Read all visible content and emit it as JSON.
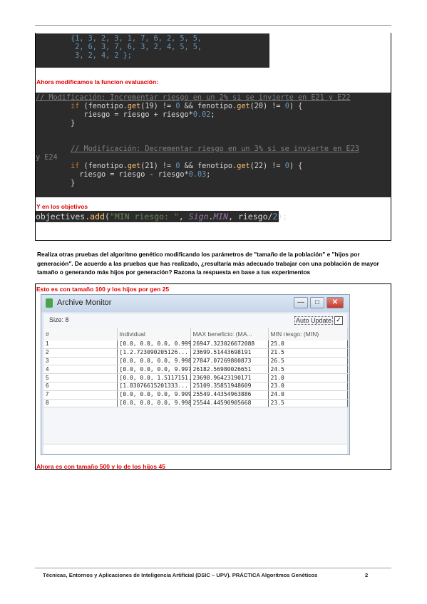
{
  "code1": {
    "lines": [
      "        {1, 3, 2, 3, 1, 7, 6, 2, 5, 5,",
      "         2, 6, 3, 7, 6, 3, 2, 4, 5, 5,",
      "         3, 2, 4, 2 };"
    ]
  },
  "label_eval": "Ahora modificamos la funcion evaluación:",
  "code2": {
    "c1": "// Modificación: Incrementar riesgo en un 2% si se invierte en E21 y E22",
    "if1_a": "if",
    "if1_b": "(fenotipo.",
    "get": "get",
    "if1_c": "(19) != ",
    "zero": "0",
    "if1_d": " && fenotipo.",
    "if1_e": "(20) != ",
    "if1_f": ") {",
    "line2_a": "riesgo = riesgo + riesgo*",
    "line2_b": "0.02",
    "semi": ";",
    "brace": "}",
    "c2a": "// Modificación: Decrementar riesgo en un 3% si se invierte en E23",
    "c2b": "y E24",
    "if2_c": "(21) != ",
    "if2_e": "(22) != ",
    "line5_a": "riesgo = riesgo - riesgo*",
    "line5_b": "0.03"
  },
  "label_obj": "Y en los objetivos",
  "code3": {
    "a": "objectives.",
    "add": "add",
    "b": "(",
    "str": "\"MIN riesgo: \"",
    "c": ", ",
    "sign": "Sign",
    "dot": ".",
    "min": "MIN",
    "d": ", riesgo/",
    "two": "2",
    "e": ");"
  },
  "paragraph": "Realiza otras pruebas del algoritmo genético modificando los parámetros de \"tamaño de la población\" e \"hijos por generación\". De acuerdo a las pruebas que has realizado, ¿resultaría más adecuado trabajar con una población de mayor tamaño o generando más hijos por generación? Razona la respuesta en base a tus experimentos",
  "label_100": "Esto es con tamaño 100 y los hijos por gen 25",
  "window": {
    "title": "Archive Monitor",
    "size": "Size: 8",
    "auto_update": "Auto Update",
    "check": "✓",
    "minimize": "—",
    "maximize": "□",
    "close": "✕",
    "headers": [
      "#",
      "Individual",
      "MAX beneficio: (MA...",
      "MIN riesgo: (MIN)"
    ],
    "rows": [
      [
        "1",
        "[0.0, 0.0, 0.0, 0.999...",
        "26947.323026672088",
        "25.0"
      ],
      [
        "2",
        "[1.2.723090205126...",
        "23699.51443698191",
        "21.5"
      ],
      [
        "3",
        "[0.0, 0.0, 0.0, 9.998...",
        "27847.07269800873",
        "26.5"
      ],
      [
        "4",
        "[0.0, 0.0, 0.0, 9.997...",
        "26182.56980026651",
        "24.5"
      ],
      [
        "5",
        "[0.0, 0.0, 1.5117151...",
        "23698.96423190171",
        "21.0"
      ],
      [
        "6",
        "[1.83076615201333...",
        "25109.35851948609",
        "23.0"
      ],
      [
        "7",
        "[0.0, 0.0, 0.0, 9.999...",
        "25549.44354963886",
        "24.0"
      ],
      [
        "8",
        "[0.0, 0.0, 0.0, 9.998...",
        "25544.44590905668",
        "23.5"
      ]
    ]
  },
  "label_500": "Ahora es con tamaño 500 y lo de los hijos 45",
  "footer": "Técnicas, Entornos y Aplicaciones de Inteligencia Artificial (DSIC – UPV). PRÁCTICA Algoritmos Genéticos",
  "page_number": "2",
  "colors": {
    "code_bg": "#2b2b2b",
    "label_red": "#e00000"
  }
}
